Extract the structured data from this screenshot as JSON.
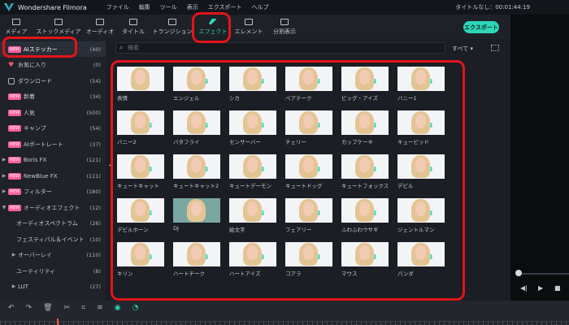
{
  "app": {
    "name": "Wondershare Filmora",
    "title_right": "タイトルなし：00:01:44:19"
  },
  "menu": [
    "ファイル",
    "編集",
    "ツール",
    "表示",
    "エクスポート",
    "ヘルプ"
  ],
  "toolbar": {
    "tabs": [
      {
        "label": "メディア",
        "icon": "folder-icon"
      },
      {
        "label": "ストックメディア",
        "icon": "stock-media-icon"
      },
      {
        "label": "オーディオ",
        "icon": "music-note-icon"
      },
      {
        "label": "タイトル",
        "icon": "text-icon"
      },
      {
        "label": "トランジション",
        "icon": "transition-icon"
      },
      {
        "label": "エフェクト",
        "icon": "effects-icon",
        "active": true
      },
      {
        "label": "エレメント",
        "icon": "element-icon"
      },
      {
        "label": "分割表示",
        "icon": "split-screen-icon"
      }
    ],
    "export_label": "エクスポート"
  },
  "sidebar": {
    "items": [
      {
        "label": "AIステッカー",
        "count": "(40)",
        "new": true,
        "selected": true
      },
      {
        "label": "お気に入り",
        "count": "(0)",
        "icon": "heart-icon"
      },
      {
        "label": "ダウンロード",
        "count": "(54)",
        "icon": "user-icon"
      },
      {
        "label": "新着",
        "count": "(34)",
        "new": true
      },
      {
        "label": "人気",
        "count": "(500)",
        "new": true
      },
      {
        "label": "キャンプ",
        "count": "(54)",
        "new": true
      },
      {
        "label": "AIポートレート",
        "count": "(37)",
        "new": true
      },
      {
        "label": "Boris FX",
        "count": "(121)",
        "new": true,
        "caret": true
      },
      {
        "label": "NewBlue FX",
        "count": "(111)",
        "new": true,
        "caret": true
      },
      {
        "label": "フィルター",
        "count": "(180)",
        "new": true,
        "caret": true
      },
      {
        "label": "オーディオエフェクト",
        "count": "(12)",
        "new": true,
        "caret": true
      },
      {
        "label": "オーディオスペクトラム",
        "count": "(26)"
      },
      {
        "label": "フェスティバル＆イベント",
        "count": "(10)"
      },
      {
        "label": "オーバーレイ",
        "count": "(110)",
        "caret": true
      },
      {
        "label": "ユーティリティ",
        "count": "(8)"
      },
      {
        "label": "LUT",
        "count": "(27)",
        "caret": true
      }
    ]
  },
  "search": {
    "placeholder": "検索",
    "filter_label": "すべて ▾"
  },
  "effects_grid": {
    "rows": [
      [
        "表情",
        "エンジェル",
        "シカ",
        "ペアテーク",
        "ビッグ・アイズ",
        "バニー1"
      ],
      [
        "バニー2",
        "バタフライ",
        "センサーバー",
        "チェリー",
        "カップケーキ",
        "キューピッド"
      ],
      [
        "キュートキャット",
        "キュートキャット2",
        "キュートデーモン",
        "キュートドッグ",
        "キュートフォックス",
        "デビル"
      ],
      [
        "デビルホーン",
        "DJ",
        "絵文字",
        "フェアリー",
        "ふわふわウサギ",
        "ジェントルマン"
      ],
      [
        "キリン",
        "ハートチーク",
        "ハートアイズ",
        "コアラ",
        "マウス",
        "パンダ"
      ]
    ]
  },
  "colors": {
    "accent": "#2fd6b9",
    "annotation": "#e3141c",
    "new_badge": "#ff5fa0"
  }
}
